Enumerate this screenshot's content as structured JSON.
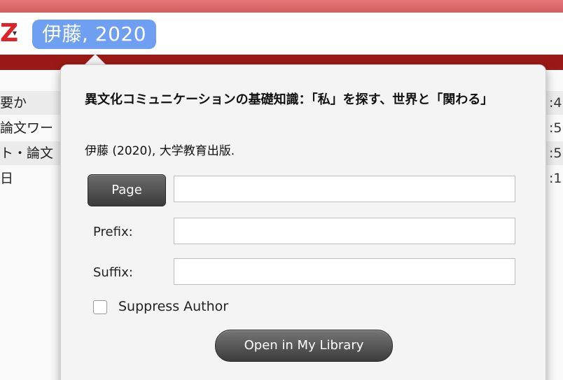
{
  "search_bar": {
    "logo_text": "Z",
    "dropdown_glyph": "▾",
    "citation_token": "伊藤, 2020"
  },
  "background_list": {
    "rows": [
      {
        "left": "要か",
        "right": ":4"
      },
      {
        "left": "論文ワー",
        "right": ":5"
      },
      {
        "left": "ト・論文",
        "right": ":5"
      },
      {
        "left": "日",
        "right": ":1"
      }
    ]
  },
  "popover": {
    "title": "異文化コミュニケーションの基礎知識：「私」を探す、世界と「関わる」",
    "citation": "伊藤 (2020), 大学教育出版.",
    "locator_button": "Page",
    "locator_value": "",
    "prefix_label": "Prefix:",
    "prefix_value": "",
    "suffix_label": "Suffix:",
    "suffix_value": "",
    "suppress_author_label": "Suppress Author",
    "suppress_author_checked": false,
    "open_button": "Open in My Library"
  },
  "colors": {
    "accent_red": "#d8262b",
    "dark_band": "#9b1a17",
    "token_blue": "#6f9ff0"
  }
}
